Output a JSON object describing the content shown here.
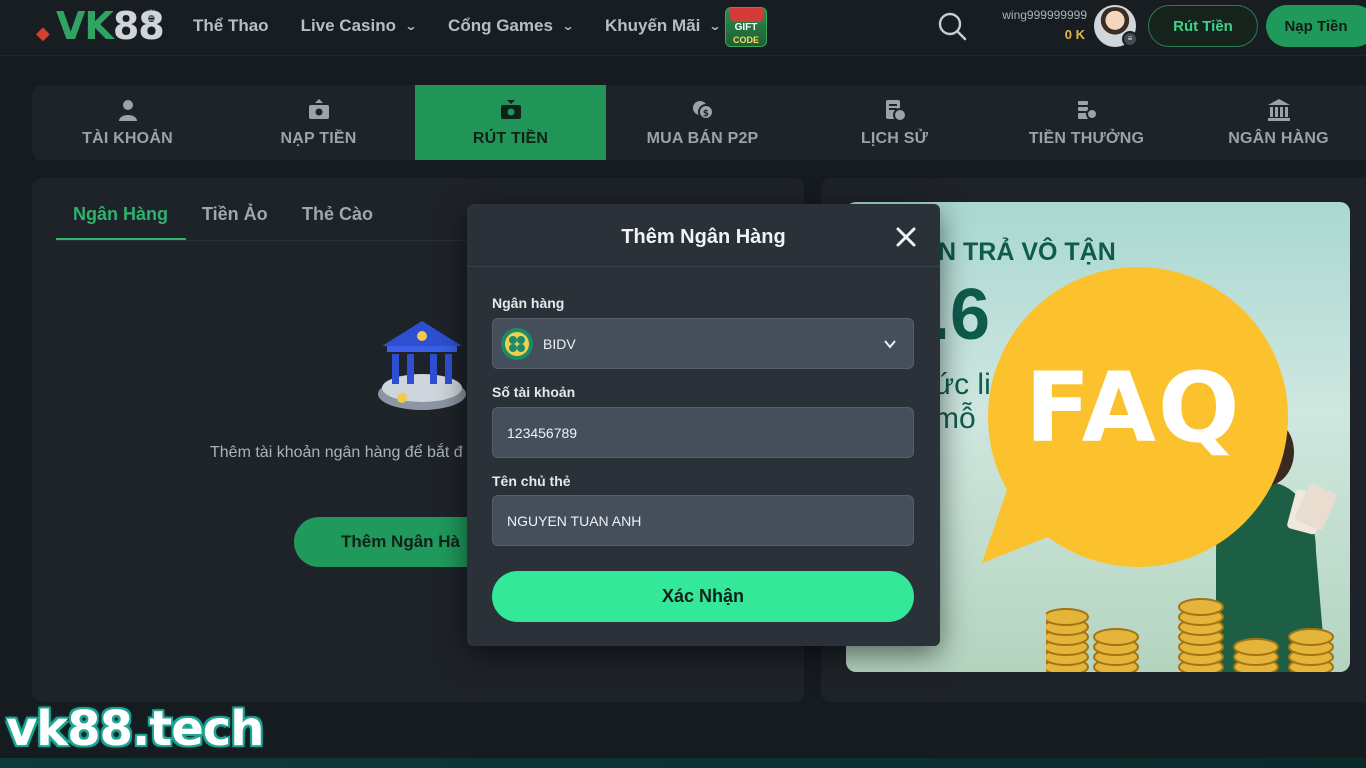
{
  "header": {
    "logo": {
      "text_a": "VK",
      "text_b": "88"
    },
    "nav": [
      {
        "label": "Thể Thao",
        "has_dropdown": false
      },
      {
        "label": "Live Casino",
        "has_dropdown": true
      },
      {
        "label": "Cổng Games",
        "has_dropdown": true
      },
      {
        "label": "Khuyến Mãi",
        "has_dropdown": true
      }
    ],
    "gift_code": {
      "line1": "GIFT",
      "line2": "CODE"
    },
    "user": {
      "name": "wing999999999",
      "balance": "0 K"
    },
    "withdraw_label": "Rút Tiền",
    "deposit_label": "Nạp Tiền"
  },
  "account_tabs": [
    {
      "label": "TÀI KHOẢN",
      "icon": "user-icon",
      "active": false
    },
    {
      "label": "NẠP TIỀN",
      "icon": "deposit-icon",
      "active": false
    },
    {
      "label": "RÚT TIỀN",
      "icon": "withdraw-icon",
      "active": true
    },
    {
      "label": "MUA BÁN P2P",
      "icon": "coins-icon",
      "active": false
    },
    {
      "label": "LỊCH SỬ",
      "icon": "history-icon",
      "active": false
    },
    {
      "label": "TIỀN THƯỞNG",
      "icon": "bonus-icon",
      "active": false
    },
    {
      "label": "NGÂN HÀNG",
      "icon": "bank-icon",
      "active": false
    }
  ],
  "left_panel": {
    "sub_tabs": [
      {
        "label": "Ngân Hàng",
        "active": true
      },
      {
        "label": "Tiền Ảo",
        "active": false
      },
      {
        "label": "Thẻ Cào",
        "active": false
      }
    ],
    "empty_text": "Thêm tài khoản ngân hàng để bắt đ",
    "add_bank_label": "Thêm Ngân Hà"
  },
  "banner": {
    "title": "N TRẢ VÔ TẬN",
    "big": ".6",
    "line1": "ức li",
    "line2": "mỗ"
  },
  "faq": {
    "text": "FAQ"
  },
  "modal": {
    "title": "Thêm Ngân Hàng",
    "bank_label": "Ngân hàng",
    "bank_value": "BIDV",
    "account_label": "Số tài khoản",
    "account_value": "123456789",
    "holder_label": "Tên chủ thẻ",
    "holder_value": "NGUYEN TUAN ANH",
    "confirm_label": "Xác Nhận"
  },
  "watermark": "vk88.tech",
  "colors": {
    "brand_green": "#219558",
    "accent_green": "#34e89a",
    "gold": "#e2b84a",
    "faq_yellow": "#fcc22d"
  }
}
